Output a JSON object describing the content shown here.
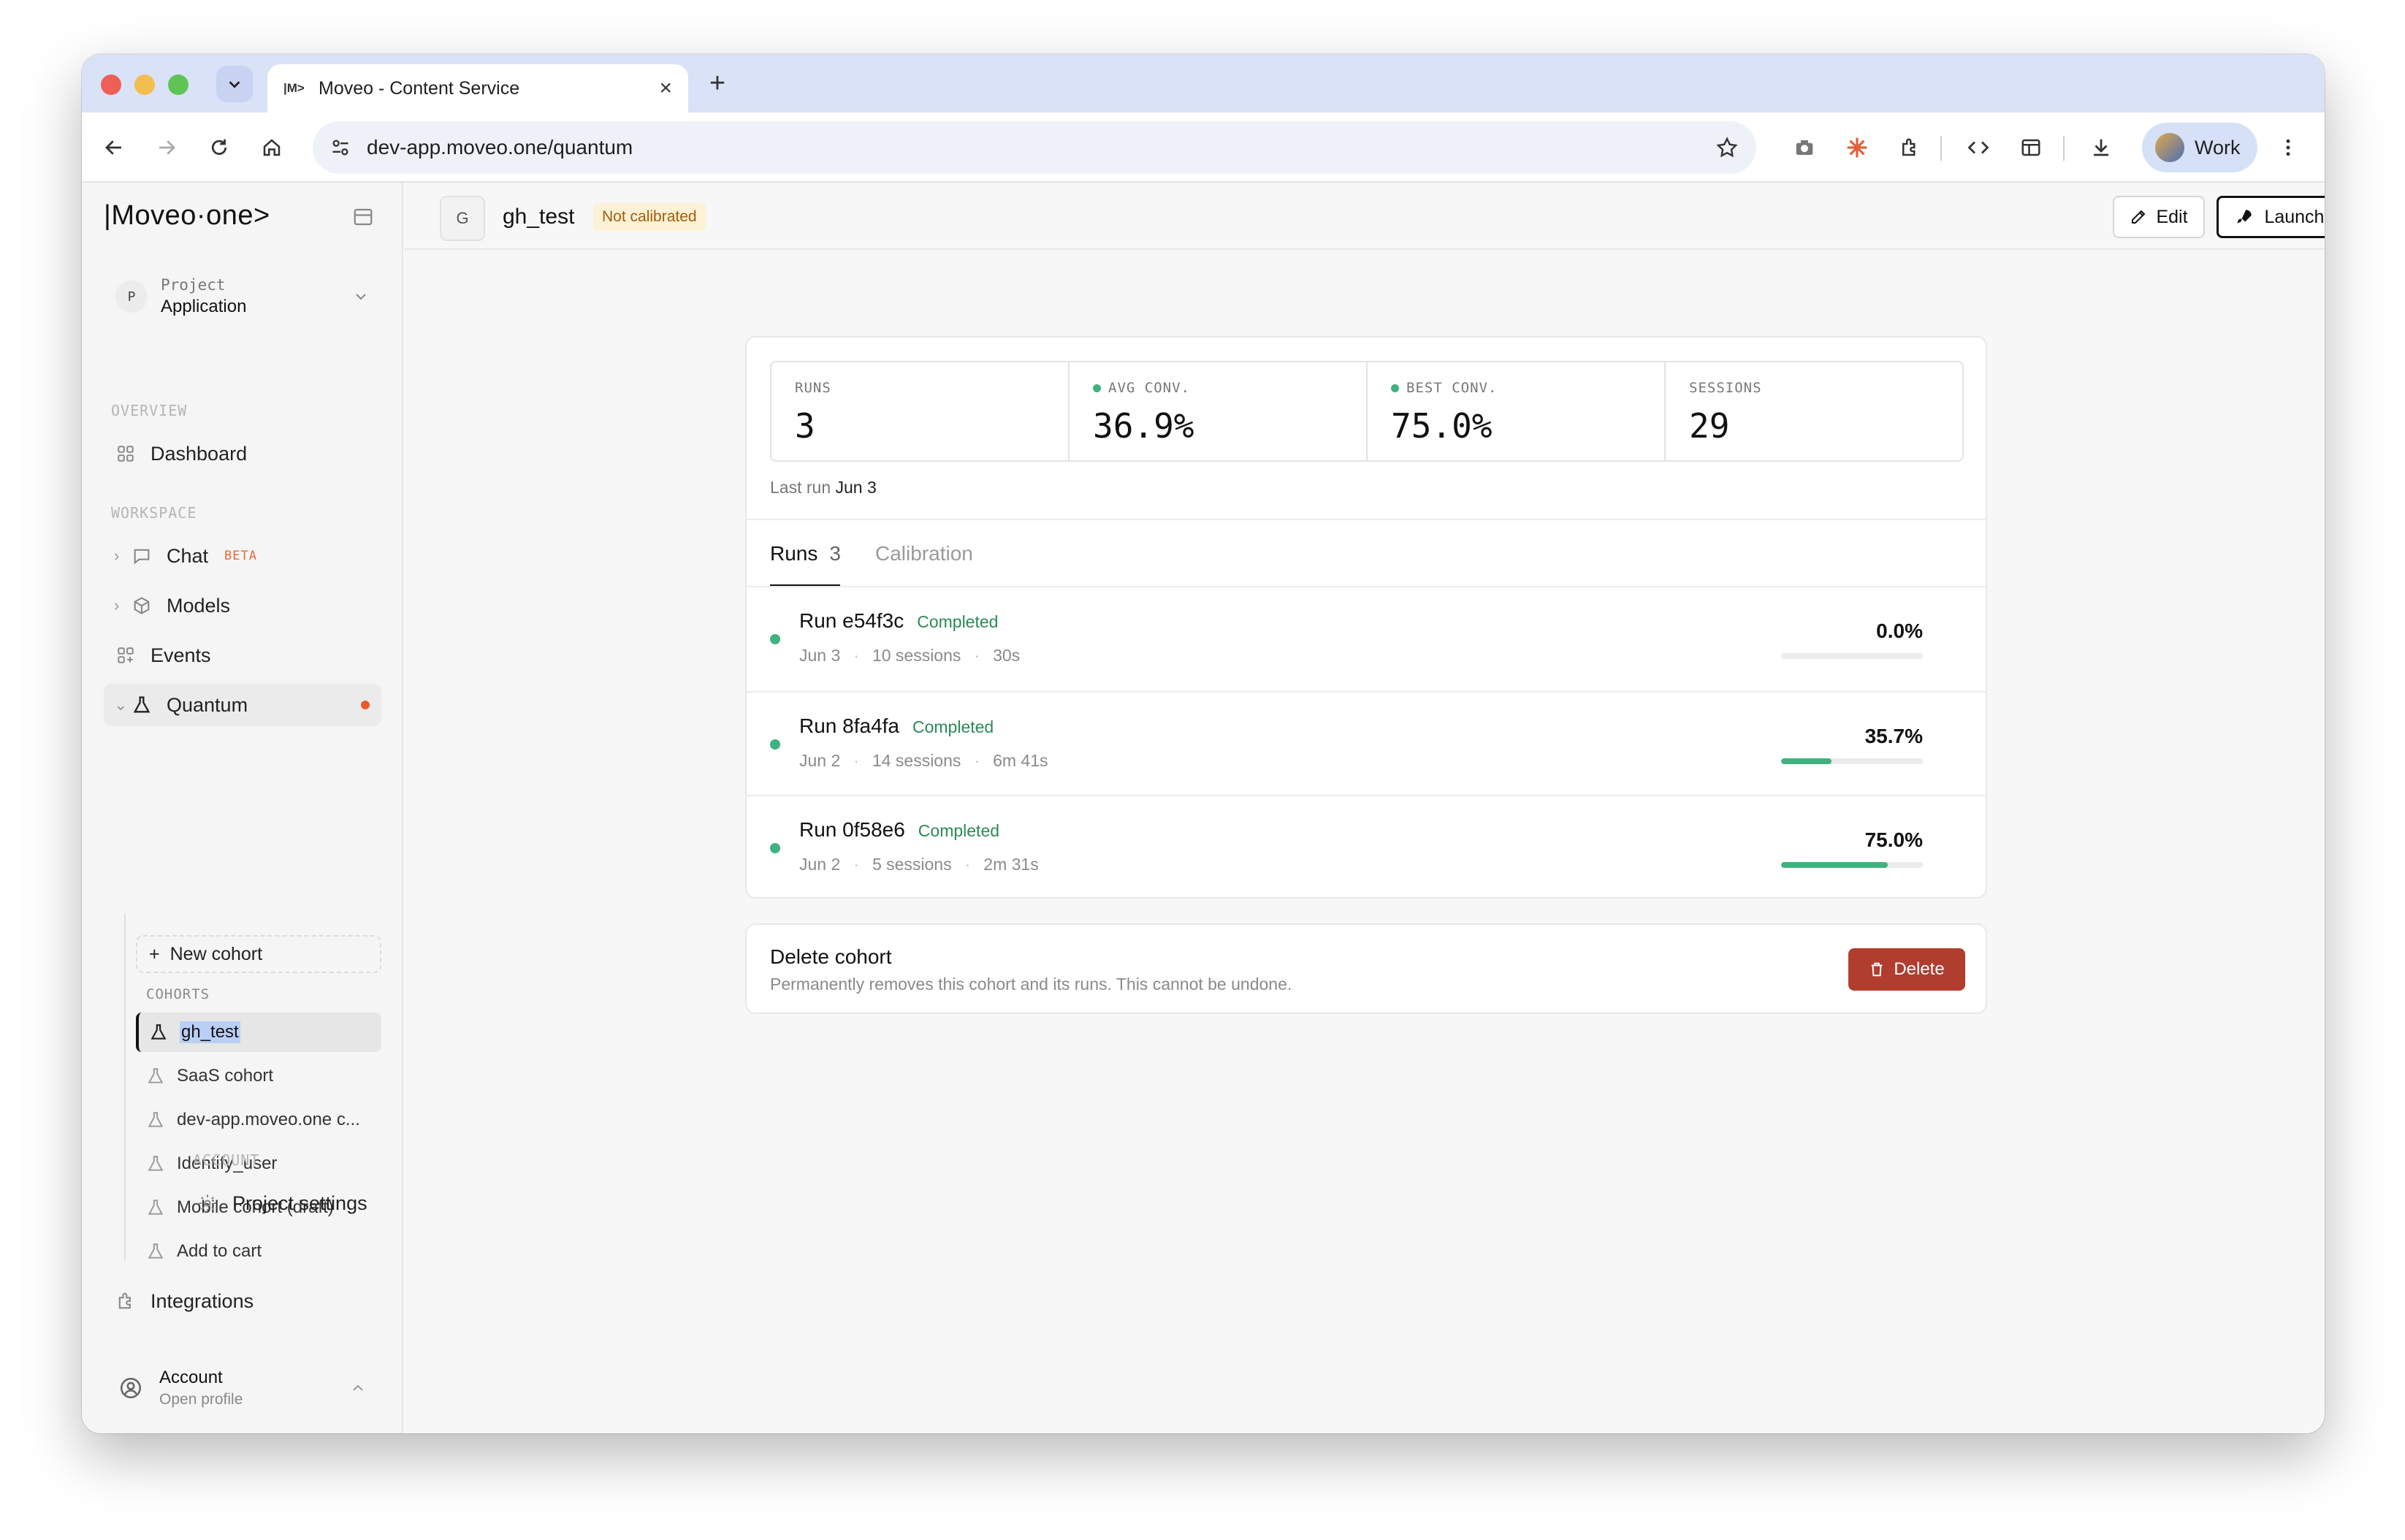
{
  "browser": {
    "tab_title": "Moveo - Content Service",
    "tab_favicon": "|M>",
    "url": "dev-app.moveo.one/quantum",
    "profile_label": "Work"
  },
  "sidebar": {
    "logo": "|Moveo·one>",
    "project_kicker": "Project",
    "project_name": "Application",
    "project_badge": "P",
    "overview_label": "OVERVIEW",
    "workspace_label": "WORKSPACE",
    "account_label": "ACCOUNT",
    "items": {
      "dashboard": "Dashboard",
      "chat": "Chat",
      "chat_badge": "BETA",
      "models": "Models",
      "events": "Events",
      "quantum": "Quantum",
      "integrations": "Integrations",
      "project_settings": "Project settings"
    },
    "new_cohort": "New cohort",
    "cohorts_label": "COHORTS",
    "cohorts": [
      "gh_test",
      "SaaS cohort",
      "dev-app.moveo.one c...",
      "Identify_user",
      "Mobile cohort (draft)",
      "Add to cart"
    ],
    "account_name": "Account",
    "account_sub": "Open profile"
  },
  "header": {
    "badge": "G",
    "title": "gh_test",
    "status": "Not calibrated",
    "edit_label": "Edit",
    "launch_label": "Launch run"
  },
  "stats": [
    {
      "label": "RUNS",
      "value": "3"
    },
    {
      "label": "AVG CONV.",
      "value": "36.9%"
    },
    {
      "label": "BEST CONV.",
      "value": "75.0%"
    },
    {
      "label": "SESSIONS",
      "value": "29"
    }
  ],
  "last_run": {
    "prefix": "Last run",
    "date": "Jun 3"
  },
  "tabs": {
    "runs": "Runs",
    "runs_count": "3",
    "calibration": "Calibration"
  },
  "runs": [
    {
      "name": "Run e54f3c",
      "status": "Completed",
      "date": "Jun 3",
      "sessions": "10 sessions",
      "duration": "30s",
      "pct": "0.0%",
      "fill": 0.0
    },
    {
      "name": "Run 8fa4fa",
      "status": "Completed",
      "date": "Jun 2",
      "sessions": "14 sessions",
      "duration": "6m 41s",
      "pct": "35.7%",
      "fill": 0.357
    },
    {
      "name": "Run 0f58e6",
      "status": "Completed",
      "date": "Jun 2",
      "sessions": "5 sessions",
      "duration": "2m 31s",
      "pct": "75.0%",
      "fill": 0.75
    }
  ],
  "danger": {
    "title": "Delete cohort",
    "description": "Permanently removes this cohort and its runs. This cannot be undone.",
    "button": "Delete"
  },
  "colors": {
    "accent_green": "#3fb27f",
    "danger": "#b03d2e",
    "status_dot": "#ea5a2a"
  }
}
